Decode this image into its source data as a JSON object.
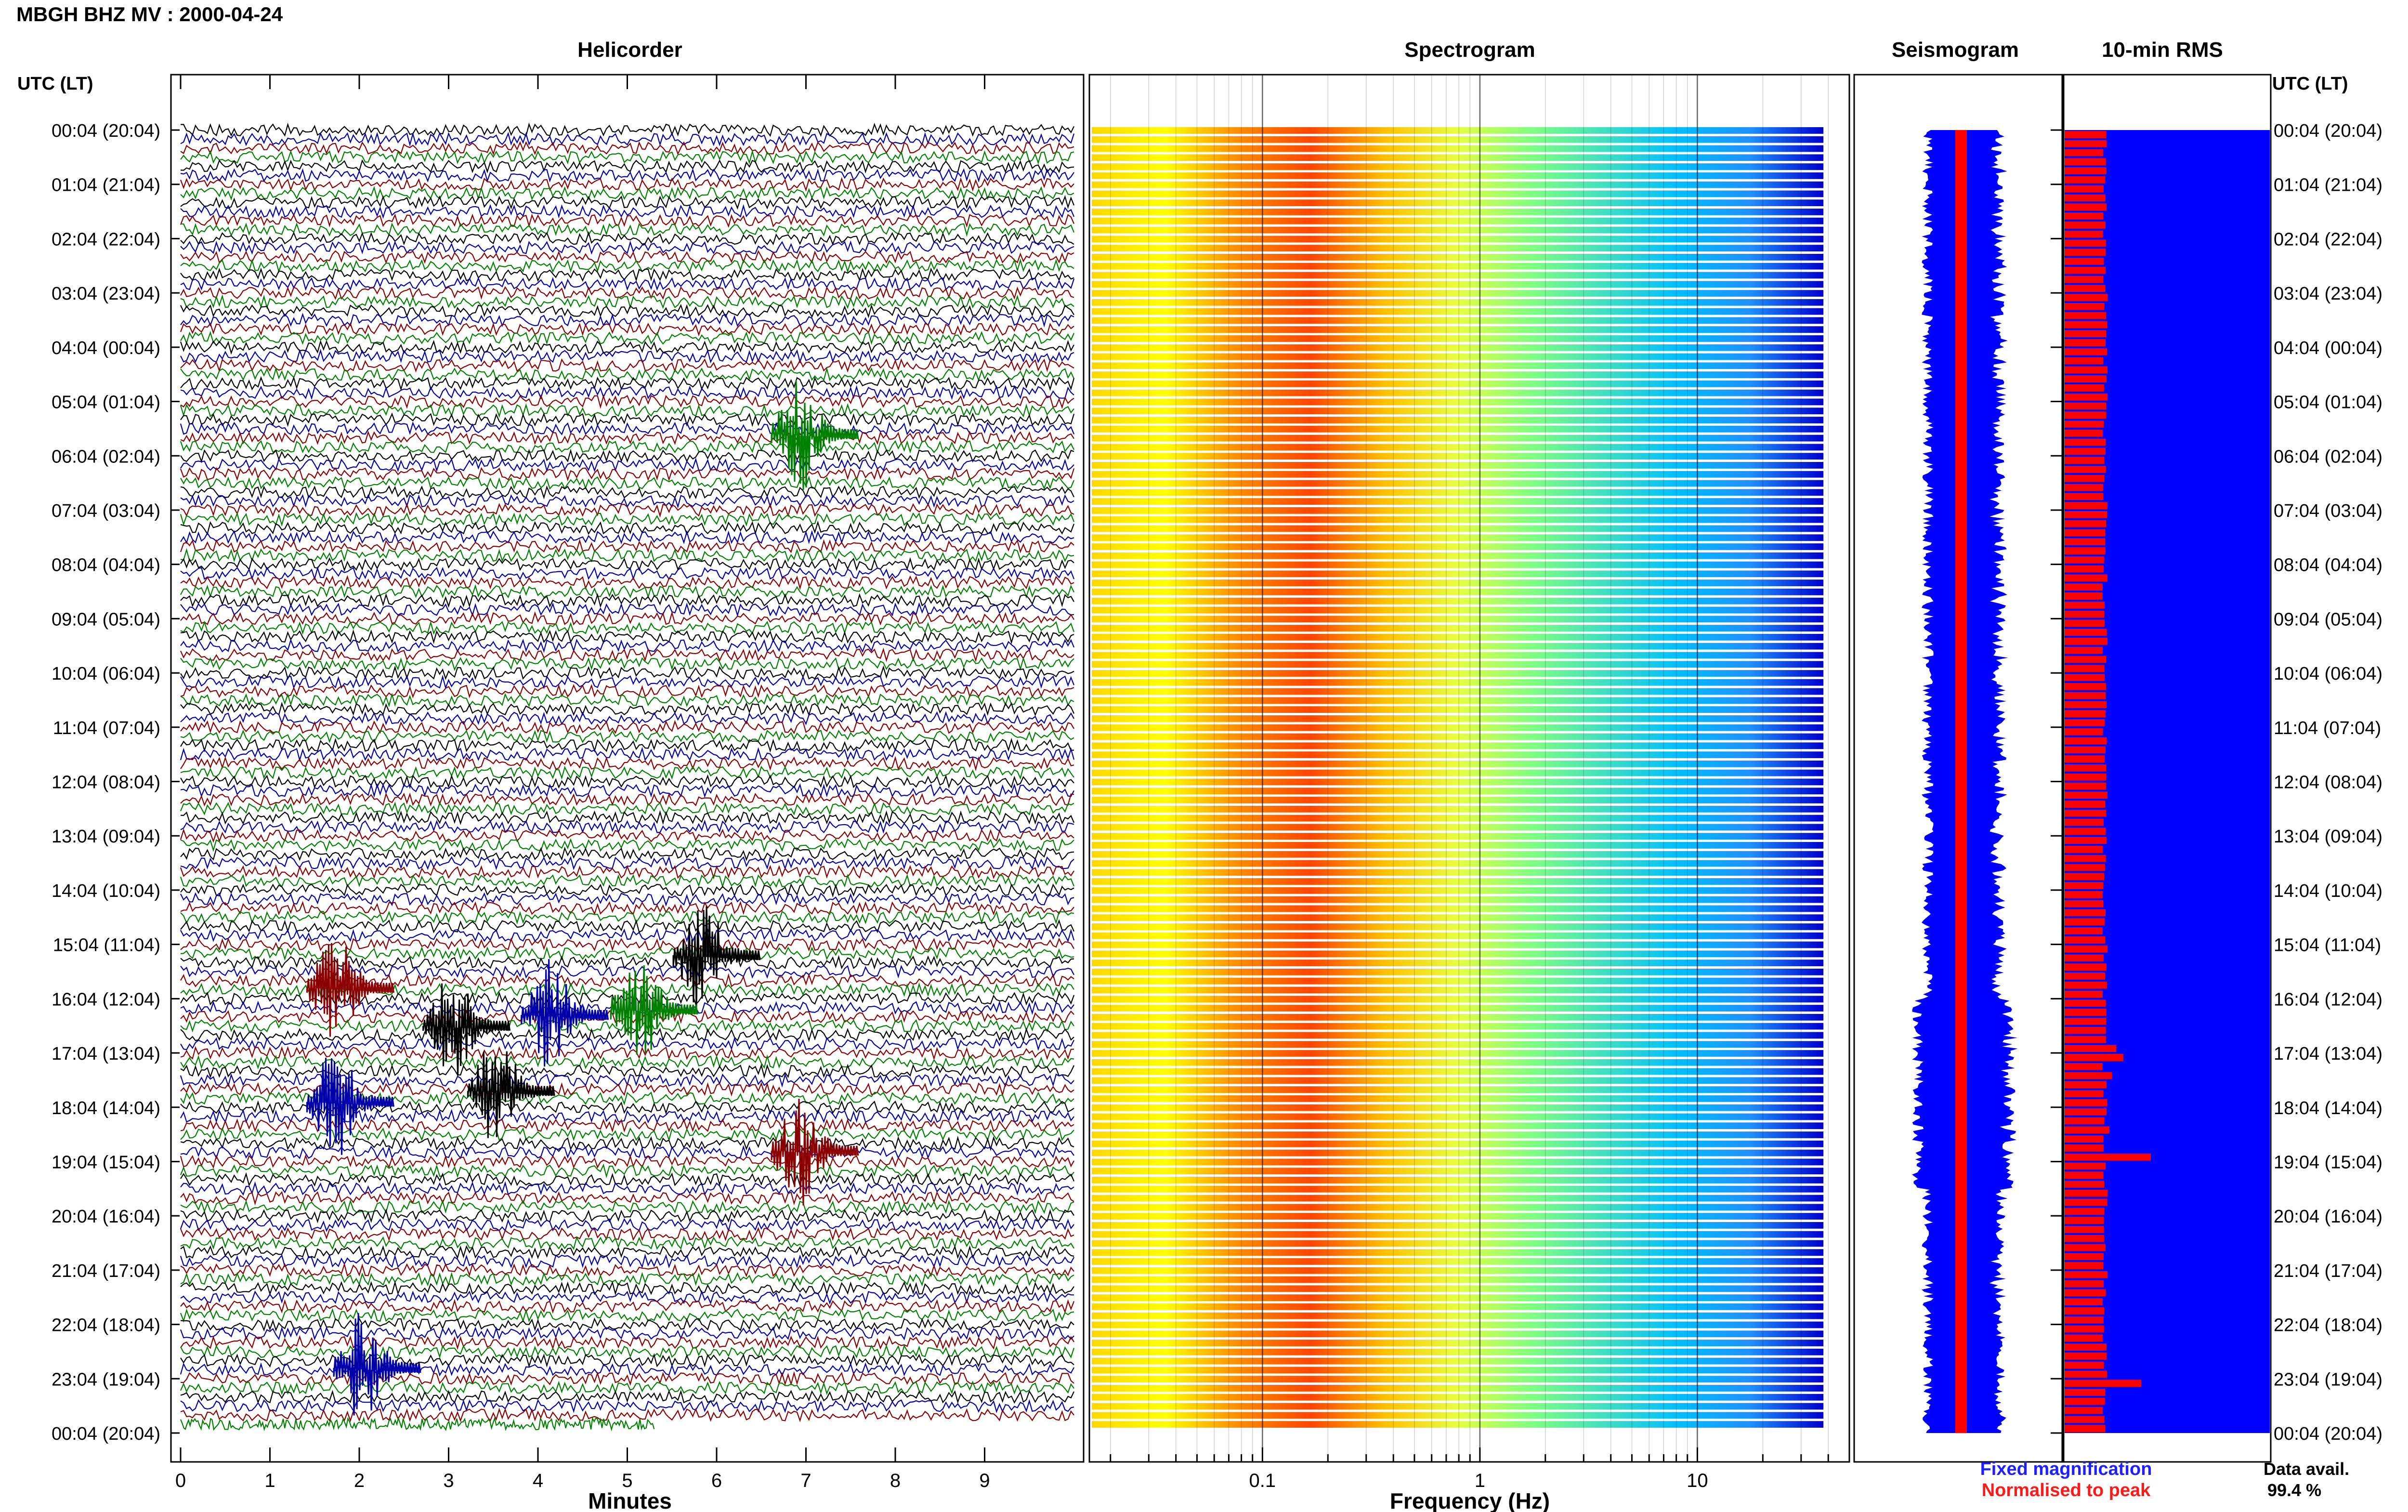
{
  "header": {
    "station_title": "MBGH BHZ MV : 2000-04-24",
    "left_time_header": "UTC (LT)",
    "right_time_header": "UTC (LT)"
  },
  "panels": {
    "helicorder": "Helicorder",
    "spectrogram": "Spectrogram",
    "seismogram": "Seismogram",
    "rms": "10-min RMS"
  },
  "legend": {
    "fixed": "Fixed magnification",
    "normalised": "Normalised to peak",
    "fixed_color": "#1f1fff",
    "normalised_color": "#ff1a1a",
    "data_avail_label": "Data avail.",
    "data_avail_value": "99.4 %"
  },
  "colors": {
    "helicorder_traces": [
      "#000000",
      "#0000aa",
      "#8b0000",
      "#008000"
    ],
    "seismogram_fill": "#0000ff",
    "seismogram_peak": "#ff0000",
    "rms_bar": "#ff0000",
    "rms_background": "#0000ff"
  },
  "chart_data": [
    {
      "type": "line",
      "name": "helicorder",
      "title": "Helicorder",
      "xlabel": "Minutes",
      "ylabel": "",
      "xlim": [
        0,
        10
      ],
      "x_ticks": [
        "0",
        "1",
        "2",
        "3",
        "4",
        "5",
        "6",
        "7",
        "8",
        "9"
      ],
      "row_labels_utc_lt": [
        "00:04 (20:04)",
        "01:04 (21:04)",
        "02:04 (22:04)",
        "03:04 (23:04)",
        "04:04 (00:04)",
        "05:04 (01:04)",
        "06:04 (02:04)",
        "07:04 (03:04)",
        "08:04 (04:04)",
        "09:04 (05:04)",
        "10:04 (06:04)",
        "11:04 (07:04)",
        "12:04 (08:04)",
        "13:04 (09:04)",
        "14:04 (10:04)",
        "15:04 (11:04)",
        "16:04 (12:04)",
        "17:04 (13:04)",
        "18:04 (14:04)",
        "19:04 (15:04)",
        "20:04 (16:04)",
        "21:04 (17:04)",
        "22:04 (18:04)",
        "23:04 (19:04)",
        "00:04 (20:04)"
      ],
      "rows_per_hour": 6,
      "events": [
        {
          "hour": 5.6,
          "minute": 7.1,
          "color_index": 3
        },
        {
          "hour": 15.2,
          "minute": 6.0,
          "color_index": 0
        },
        {
          "hour": 15.8,
          "minute": 1.9,
          "color_index": 2
        },
        {
          "hour": 16.2,
          "minute": 5.3,
          "color_index": 3
        },
        {
          "hour": 16.3,
          "minute": 4.3,
          "color_index": 1
        },
        {
          "hour": 16.5,
          "minute": 3.2,
          "color_index": 0
        },
        {
          "hour": 17.7,
          "minute": 3.7,
          "color_index": 0
        },
        {
          "hour": 17.9,
          "minute": 1.9,
          "color_index": 1
        },
        {
          "hour": 18.8,
          "minute": 7.1,
          "color_index": 2
        },
        {
          "hour": 22.8,
          "minute": 2.2,
          "color_index": 1
        }
      ]
    },
    {
      "type": "heatmap",
      "name": "spectrogram",
      "title": "Spectrogram",
      "xlabel": "Frequency (Hz)",
      "x_scale": "log",
      "xlim": [
        0.016,
        50
      ],
      "x_tick_labels": [
        {
          "value": 0.1,
          "label": "0.1"
        },
        {
          "value": 1,
          "label": "1"
        },
        {
          "value": 10,
          "label": "10"
        }
      ],
      "colormap": [
        "#ffd700",
        "#ffff00",
        "#ff8c00",
        "#ff4500",
        "#ffc000",
        "#e6ff40",
        "#80ff80",
        "#40e0c0",
        "#00bfff",
        "#1e90ff",
        "#0000cd"
      ],
      "peak_band_hz": [
        0.2,
        0.5
      ]
    },
    {
      "type": "line",
      "name": "seismogram",
      "title": "Seismogram",
      "legend": [
        "Fixed magnification",
        "Normalised to peak"
      ]
    },
    {
      "type": "bar",
      "name": "10-min RMS",
      "title": "10-min RMS",
      "orientation": "horizontal",
      "rows": 144,
      "baseline_fraction": 0.5,
      "spikes": [
        {
          "hour": 16.9,
          "fraction": 0.6
        },
        {
          "hour": 17.05,
          "fraction": 0.68
        },
        {
          "hour": 17.4,
          "fraction": 0.55
        },
        {
          "hour": 18.3,
          "fraction": 0.52
        },
        {
          "hour": 18.85,
          "fraction": 1.0
        },
        {
          "hour": 22.95,
          "fraction": 0.89
        },
        {
          "hour": 19.5,
          "fraction": 0.5
        }
      ]
    }
  ]
}
